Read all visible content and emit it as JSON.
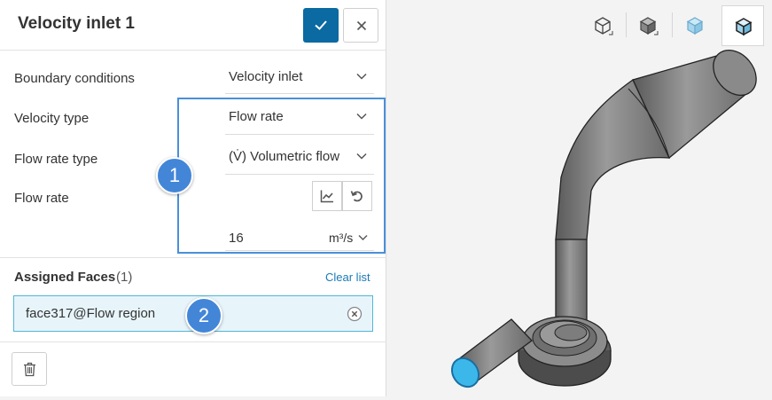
{
  "panel": {
    "title": "Velocity inlet 1",
    "confirm_icon": "check-icon",
    "close_icon": "close-icon"
  },
  "fields": {
    "boundary_conditions": {
      "label": "Boundary conditions",
      "value": "Velocity inlet"
    },
    "velocity_type": {
      "label": "Velocity type",
      "value": "Flow rate"
    },
    "flow_rate_type": {
      "label": "Flow rate type",
      "value": "(V̇) Volumetric flow"
    },
    "flow_rate": {
      "label": "Flow rate",
      "value": "16",
      "unit": "m³/s"
    }
  },
  "annotations": {
    "badge_1": "1",
    "badge_2": "2",
    "highlight_color": "#4a8fd9"
  },
  "assigned_faces": {
    "title": "Assigned Faces",
    "count": "(1)",
    "clear_label": "Clear list",
    "items": [
      "face317@Flow region"
    ]
  },
  "colors": {
    "primary": "#0a6aa1",
    "link": "#1a7ab5",
    "face_bg": "#e7f5fb",
    "face_border": "#52b6d6",
    "inlet_face": "#3cb7ea"
  },
  "viewport": {
    "view_buttons": [
      "wireframe-view-icon",
      "solid-view-icon",
      "transparent-view-icon",
      "edges-view-icon"
    ],
    "active_view": "edges-view-icon"
  }
}
